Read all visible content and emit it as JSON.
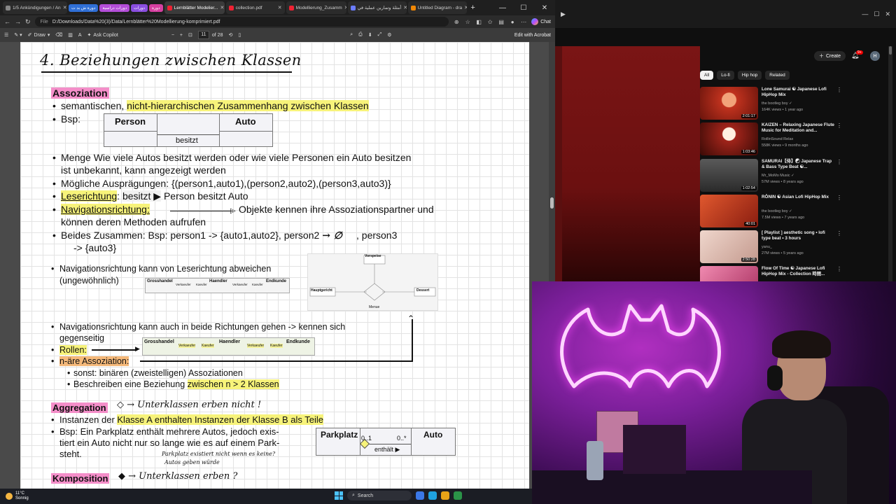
{
  "browser": {
    "tabs": [
      {
        "label": "1/5 Ankündigungen / An",
        "active": false
      },
      {
        "label": "Lernblätter Modelier...",
        "active": true
      },
      {
        "label": "collection.pdf",
        "active": false
      },
      {
        "label": "Modellierung_Zusamm",
        "active": false
      },
      {
        "label": "أمثلة وتمارين عملية في",
        "active": false
      },
      {
        "label": "Untitled Diagram - dra",
        "active": false
      }
    ],
    "chips": [
      {
        "label": "دورة ش بد ت",
        "color": "#2f6fd6"
      },
      {
        "label": "دورات دراسية",
        "color": "#b34dd8"
      },
      {
        "label": "دورات",
        "color": "#8a4ee0"
      },
      {
        "label": "دورة",
        "color": "#d63fa0"
      }
    ],
    "url_label": "File",
    "url": "D:/Downloads/Data%20(3)/Data/Lernblätter%20Modellierung-komprimiert.pdf",
    "chat_label": "Chat"
  },
  "pdf_toolbar": {
    "draw_label": "Draw",
    "copilot_label": "Ask Copilot",
    "page_current": "11",
    "page_total": "of 28",
    "edit_label": "Edit with Acrobat"
  },
  "slide": {
    "heading": "4. Beziehungen zwischen Klassen",
    "assoziation": "Assoziation",
    "l1a": "semantischen, ",
    "l1b": "nicht-hierarchischen Zusammenhang zwischen Klassen",
    "bsp": "Bsp:",
    "uml1": {
      "left": "Person",
      "right": "Auto",
      "label": "besitzt"
    },
    "l2": "Menge Wie viele Autos besitzt werden oder wie viele Personen ein Auto besitzen",
    "l2b": "ist unbekannt, kann angezeigt werden",
    "l3": "Mögliche Ausprägungen: {(person1,auto1),(person2,auto2),(person3,auto3)}",
    "l4a": "Leserichtung",
    "l4b": ":",
    "l4c": "besitzt ▶",
    "l4d": "Person besitzt Auto",
    "l5a": "Navigationsrichtung:",
    "l5b": "Objekte kennen ihre Assoziationspartner und",
    "l5c": "können deren Methoden aufrufen",
    "l6a": "Beides Zusammen: Bsp: person1 -> {auto1,auto2}, person2",
    "l6b": "→ ∅",
    "l6c": ", person3",
    "l6d": "-> {auto3}",
    "n1a": "Navigationsrichtung kann von Leserichtung abweichen",
    "n1b": "(ungewöhnlich)",
    "diagram1": [
      "Grosshandel",
      "Verkaeufer",
      "Kaeufer",
      "Haendler",
      "Verkaeufer",
      "Kaeufer",
      "Endkunde"
    ],
    "diagram2": [
      "Vorspeise",
      "Hauptgericht",
      "Dessert",
      "Menue"
    ],
    "n2a": "Navigationsrichtung kann auch in beide Richtungen gehen -> kennen sich",
    "n2b": "gegenseitig",
    "rollen": "Rollen:",
    "diagram3": [
      "Grosshandel",
      "Verkaeufer",
      "Kaeufer",
      "Haendler",
      "Verkaeufer",
      "Kaeufer",
      "Endkunde"
    ],
    "nare": "n-äre Assoziation:",
    "sub1": "sonst: binären (zweistelligen) Assoziationen",
    "sub2a": "Beschreiben eine Beziehung ",
    "sub2b": "zwischen n > 2 Klassen",
    "aggregation": "Aggregation",
    "agg_note": "◇ → Unterklassen erben nicht !",
    "a1a": "Instanzen der ",
    "a1b": "Klasse A enthalten Instanzen der Klasse B als Teile",
    "a2": "Bsp: Ein Parkplatz enthält mehrere Autos, jedoch exis-",
    "a3": "tiert ein Auto nicht nur so lange wie es auf einem Park-",
    "a4": "steht.",
    "uml2": {
      "left": "Parkplatz",
      "right": "Auto",
      "label": "enthält ▶",
      "m1": "0..1",
      "m2": "0..*"
    },
    "hand_note1": "Parkplatz existiert nicht wenn es keine?",
    "hand_note2": "Autos geben würde",
    "komposition": "Komposition",
    "komp_note": "◆ → Unterklassen erben ?"
  },
  "youtube": {
    "create_label": "Create",
    "bell_badge": "9+",
    "avatar_letter": "H",
    "filters": [
      "All",
      "Lo-fi",
      "Hip hop",
      "Related"
    ],
    "videos": [
      {
        "title": "Lone Samurai ☯ Japanese Lofi HipHop Mix",
        "channel": "the bootleg boy ✓",
        "meta": "164K views • 1 year ago",
        "duration": "2:01:17",
        "color": "#c0321e"
      },
      {
        "title": "KAIZEN – Relaxing Japanese Flute Music for Meditation and...",
        "channel": "RollinSound Relax",
        "meta": "558K views • 9 months ago",
        "duration": "1:03:46",
        "color": "#a0241a"
      },
      {
        "title": "SAMURAI【侍】☯ Japanese Trap & Bass Type Beat ☯...",
        "channel": "Mr_MoMo Music ✓",
        "meta": "57M views • 8 years ago",
        "duration": "1:02:54",
        "color": "#3a3a3a"
      },
      {
        "title": "RŌNIN ☯ Asian Lofi HipHop Mix",
        "channel": "the bootleg boy ✓",
        "meta": "7.5M views • 7 years ago",
        "duration": "40:01",
        "color": "#b8361d"
      },
      {
        "title": "[ Playlist ] aesthetic song • lofi type beat • 3 hours",
        "channel": "yanu_",
        "meta": "27M views • 5 years ago",
        "duration": "2:50:28",
        "color": "#d6b5a8"
      },
      {
        "title": "Flow Of Time ☯ Japanese Lofi HipHop Mix - Collection 時間...",
        "channel": "",
        "meta": "",
        "duration": "",
        "color": "#d25a86"
      }
    ]
  },
  "taskbar": {
    "temp": "11°C",
    "weather": "Sonnig",
    "search_label": "Search"
  }
}
